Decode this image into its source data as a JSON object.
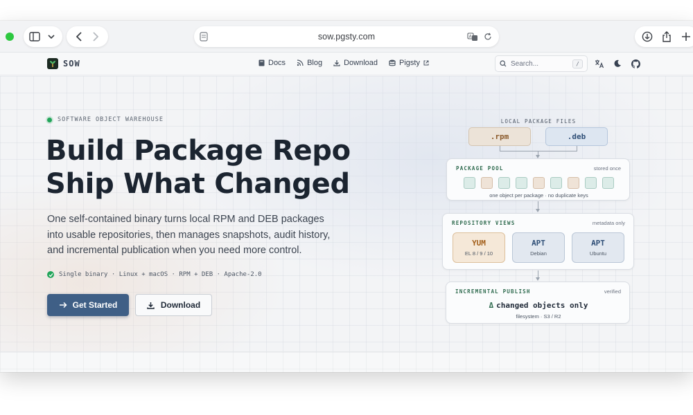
{
  "browser": {
    "url": "sow.pgsty.com",
    "icons": [
      "sidebar-icon",
      "chevron-down-icon",
      "back-icon",
      "forward-icon",
      "reader-icon",
      "translate-icon",
      "reload-icon",
      "downloads-icon",
      "share-icon",
      "new-tab-icon"
    ]
  },
  "header": {
    "brand": "SOW",
    "nav": [
      {
        "label": "Docs",
        "icon": "book-icon"
      },
      {
        "label": "Blog",
        "icon": "rss-icon"
      },
      {
        "label": "Download",
        "icon": "download-icon"
      },
      {
        "label": "Pigsty",
        "icon": "database-icon",
        "external": true
      }
    ],
    "search": {
      "placeholder": "Search...",
      "shortcut": "/"
    },
    "icons": [
      "translate-icon",
      "moon-icon",
      "github-icon"
    ]
  },
  "hero": {
    "eyebrow": "SOFTWARE OBJECT WAREHOUSE",
    "headline_line1": "Build Package Repo",
    "headline_line2": "Ship What Changed",
    "lead": "One self-contained binary turns local RPM and DEB packages into usable repositories, then manages snapshots, audit history, and incremental publication when you need more control.",
    "features": "Single binary · Linux + macOS · RPM + DEB · Apache-2.0",
    "primary_button": "Get Started",
    "secondary_button": "Download"
  },
  "diagram": {
    "files_title": "LOCAL PACKAGE FILES",
    "files": [
      ".rpm",
      ".deb"
    ],
    "pool": {
      "title": "PACKAGE POOL",
      "meta": "stored once",
      "cells": [
        "green",
        "tan",
        "green",
        "green",
        "tan",
        "green",
        "tan",
        "green",
        "green"
      ],
      "caption": "one object per package · no duplicate keys"
    },
    "views": {
      "title": "REPOSITORY VIEWS",
      "meta": "metadata only",
      "cards": [
        {
          "name": "YUM",
          "sub": "EL 8 / 9 / 10"
        },
        {
          "name": "APT",
          "sub": "Debian"
        },
        {
          "name": "APT",
          "sub": "Ubuntu"
        }
      ]
    },
    "publish": {
      "title": "INCREMENTAL PUBLISH",
      "meta": "verified",
      "delta": "Δ",
      "main": "changed objects only",
      "sub": "filesystem · S3 / R2"
    }
  },
  "colors": {
    "accent": "#3f5f86",
    "success": "#22a55a",
    "panel_title": "#2f6b4f",
    "rpm": "#8b5a2b",
    "deb": "#2f4f77",
    "yum": "#a35f1a"
  }
}
